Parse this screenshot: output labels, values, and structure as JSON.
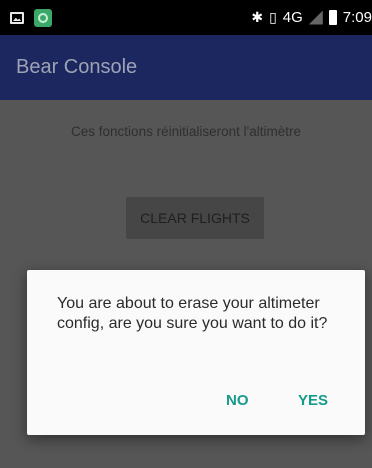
{
  "status_bar": {
    "icons": [
      "photo-icon",
      "app-notification-icon",
      "bluetooth-icon",
      "vibrate-icon",
      "signal-icon",
      "battery-icon"
    ],
    "network": "4G",
    "time": "7:09"
  },
  "app_bar": {
    "title": "Bear Console"
  },
  "content": {
    "description": "Ces fonctions réinitialiseront l'altimètre",
    "clear_flights_label": "CLEAR FLIGHTS"
  },
  "dialog": {
    "message": "You are about to erase your altimeter config, are you sure you want to do it?",
    "no_label": "NO",
    "yes_label": "YES"
  },
  "colors": {
    "app_bar": "#1b275e",
    "accent": "#149b8a",
    "dim_background": "#565656"
  }
}
